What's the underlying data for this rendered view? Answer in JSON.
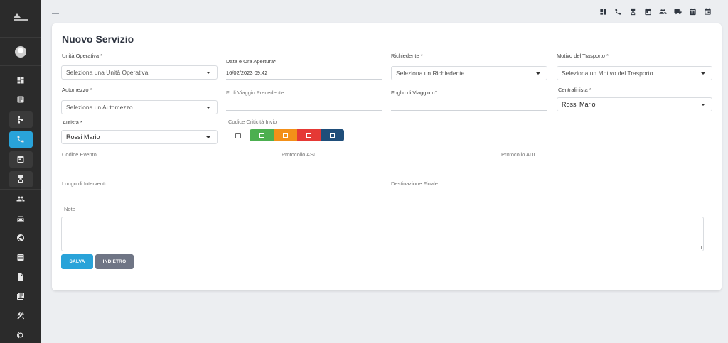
{
  "app": {
    "menu_icon": "hamburger-menu-icon",
    "top_icons": [
      "dashboard-icon",
      "phone-icon",
      "hourglass-icon",
      "calendar-icon",
      "people-icon",
      "truck-icon",
      "calendar-grid-icon",
      "calendar-event-icon"
    ]
  },
  "sidebar": {
    "items": [
      {
        "icon": "dashboard-icon"
      },
      {
        "icon": "document-list-icon"
      },
      {
        "icon": "flow-icon"
      },
      {
        "icon": "phone-icon",
        "active": true
      },
      {
        "icon": "calendar-icon"
      },
      {
        "icon": "hourglass-icon"
      },
      {
        "icon": "people-icon"
      },
      {
        "icon": "car-icon"
      },
      {
        "icon": "globe-icon"
      },
      {
        "icon": "calendar-grid-icon"
      },
      {
        "icon": "file-icon"
      },
      {
        "icon": "copy-icon"
      },
      {
        "icon": "tools-icon"
      },
      {
        "icon": "cycle-icon"
      }
    ]
  },
  "form": {
    "title": "Nuovo Servizio",
    "unita_operativa": {
      "label": "Unità Operativa *",
      "placeholder": "Seleziona una Unità Operativa"
    },
    "data_apertura": {
      "label": "Data e Ora Apertura*",
      "value": "16/02/2023 09:42"
    },
    "richiedente": {
      "label": "Richiedente *",
      "placeholder": "Seleziona un Richiedente"
    },
    "motivo_trasporto": {
      "label": "Motivo del Trasporto *",
      "placeholder": "Seleziona un Motivo del Trasporto"
    },
    "automezzo": {
      "label": "Automezzo *",
      "placeholder": "Seleziona un Automezzo"
    },
    "foglio_precedente": {
      "label": "F. di Viaggio Precedente",
      "value": ""
    },
    "foglio_viaggio": {
      "label": "Foglio di Viaggio n°",
      "value": ""
    },
    "centralinista": {
      "label": "Centralinista *",
      "value": "Rossi Mario"
    },
    "autista": {
      "label": "Autista *",
      "value": "Rossi Mario"
    },
    "codice_criticita": {
      "label": "Codice Criticità Invio",
      "colors": [
        "#4caf50",
        "#f39019",
        "#e53935",
        "#1f4e7a"
      ]
    },
    "codice_evento": {
      "label": "Codice Evento",
      "value": ""
    },
    "protocollo_asl": {
      "label": "Protocollo ASL",
      "value": ""
    },
    "protocollo_adi": {
      "label": "Protocollo ADI",
      "value": ""
    },
    "luogo_intervento": {
      "label": "Luogo di Intervento",
      "value": ""
    },
    "destinazione_finale": {
      "label": "Destinazione Finale",
      "value": ""
    },
    "note": {
      "label": "Note",
      "value": ""
    },
    "buttons": {
      "save": "SALVA",
      "back": "INDIETRO",
      "save_color": "#29a3d9",
      "back_color": "#6f7585"
    }
  }
}
